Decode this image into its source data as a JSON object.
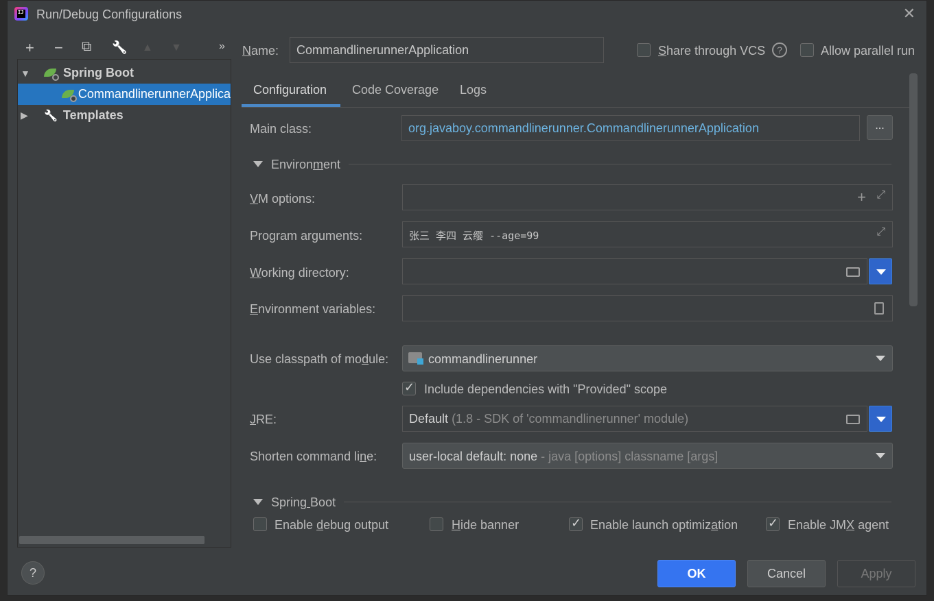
{
  "window": {
    "title": "Run/Debug Configurations",
    "app_icon_text": "IJ"
  },
  "toolbar": {
    "add": "+",
    "remove": "−",
    "copy": "⧉",
    "edit": "🔧",
    "up": "▲",
    "down": "▼",
    "more": "»"
  },
  "tree": {
    "group": "Spring Boot",
    "item": "CommandlinerunnerApplica",
    "templates": "Templates"
  },
  "header": {
    "name_label": "Name:",
    "name_value": "CommandlinerunnerApplication",
    "share_vcs": "Share through VCS",
    "share_vcs_checked": false,
    "allow_parallel": "Allow parallel run",
    "allow_parallel_checked": false
  },
  "tabs": [
    "Configuration",
    "Code Coverage",
    "Logs"
  ],
  "form": {
    "main_class_label": "Main class:",
    "main_class_value": "org.javaboy.commandlinerunner.CommandlinerunnerApplication",
    "browse_label": "...",
    "environment_label": "Environment",
    "vm_options_label": "VM options:",
    "vm_options_value": "",
    "program_args_label": "Program arguments:",
    "program_args_value": "张三 李四 云缨 --age=99",
    "working_dir_label": "Working directory:",
    "working_dir_value": "",
    "env_vars_label": "Environment variables:",
    "env_vars_value": "",
    "classpath_label": "Use classpath of module:",
    "classpath_value": "commandlinerunner",
    "include_deps_label": "Include dependencies with \"Provided\" scope",
    "include_deps_checked": true,
    "jre_label": "JRE:",
    "jre_value": "Default",
    "jre_detail": "(1.8 - SDK of 'commandlinerunner' module)",
    "shorten_label": "Shorten command line:",
    "shorten_value": "user-local default: none",
    "shorten_detail": "- java [options] classname [args]"
  },
  "spring_boot": {
    "section_label": "Spring Boot",
    "debug_output": "Enable debug output",
    "debug_output_checked": false,
    "hide_banner": "Hide banner",
    "hide_banner_checked": false,
    "launch_opt": "Enable launch optimization",
    "launch_opt_checked": true,
    "jmx_agent": "Enable JMX agent",
    "jmx_agent_checked": true
  },
  "buttons": {
    "ok": "OK",
    "cancel": "Cancel",
    "apply": "Apply",
    "help": "?"
  },
  "colors": {
    "accent": "#2675bf",
    "primary_button": "#3574f0",
    "main_class_text": "#6cb3e0"
  }
}
